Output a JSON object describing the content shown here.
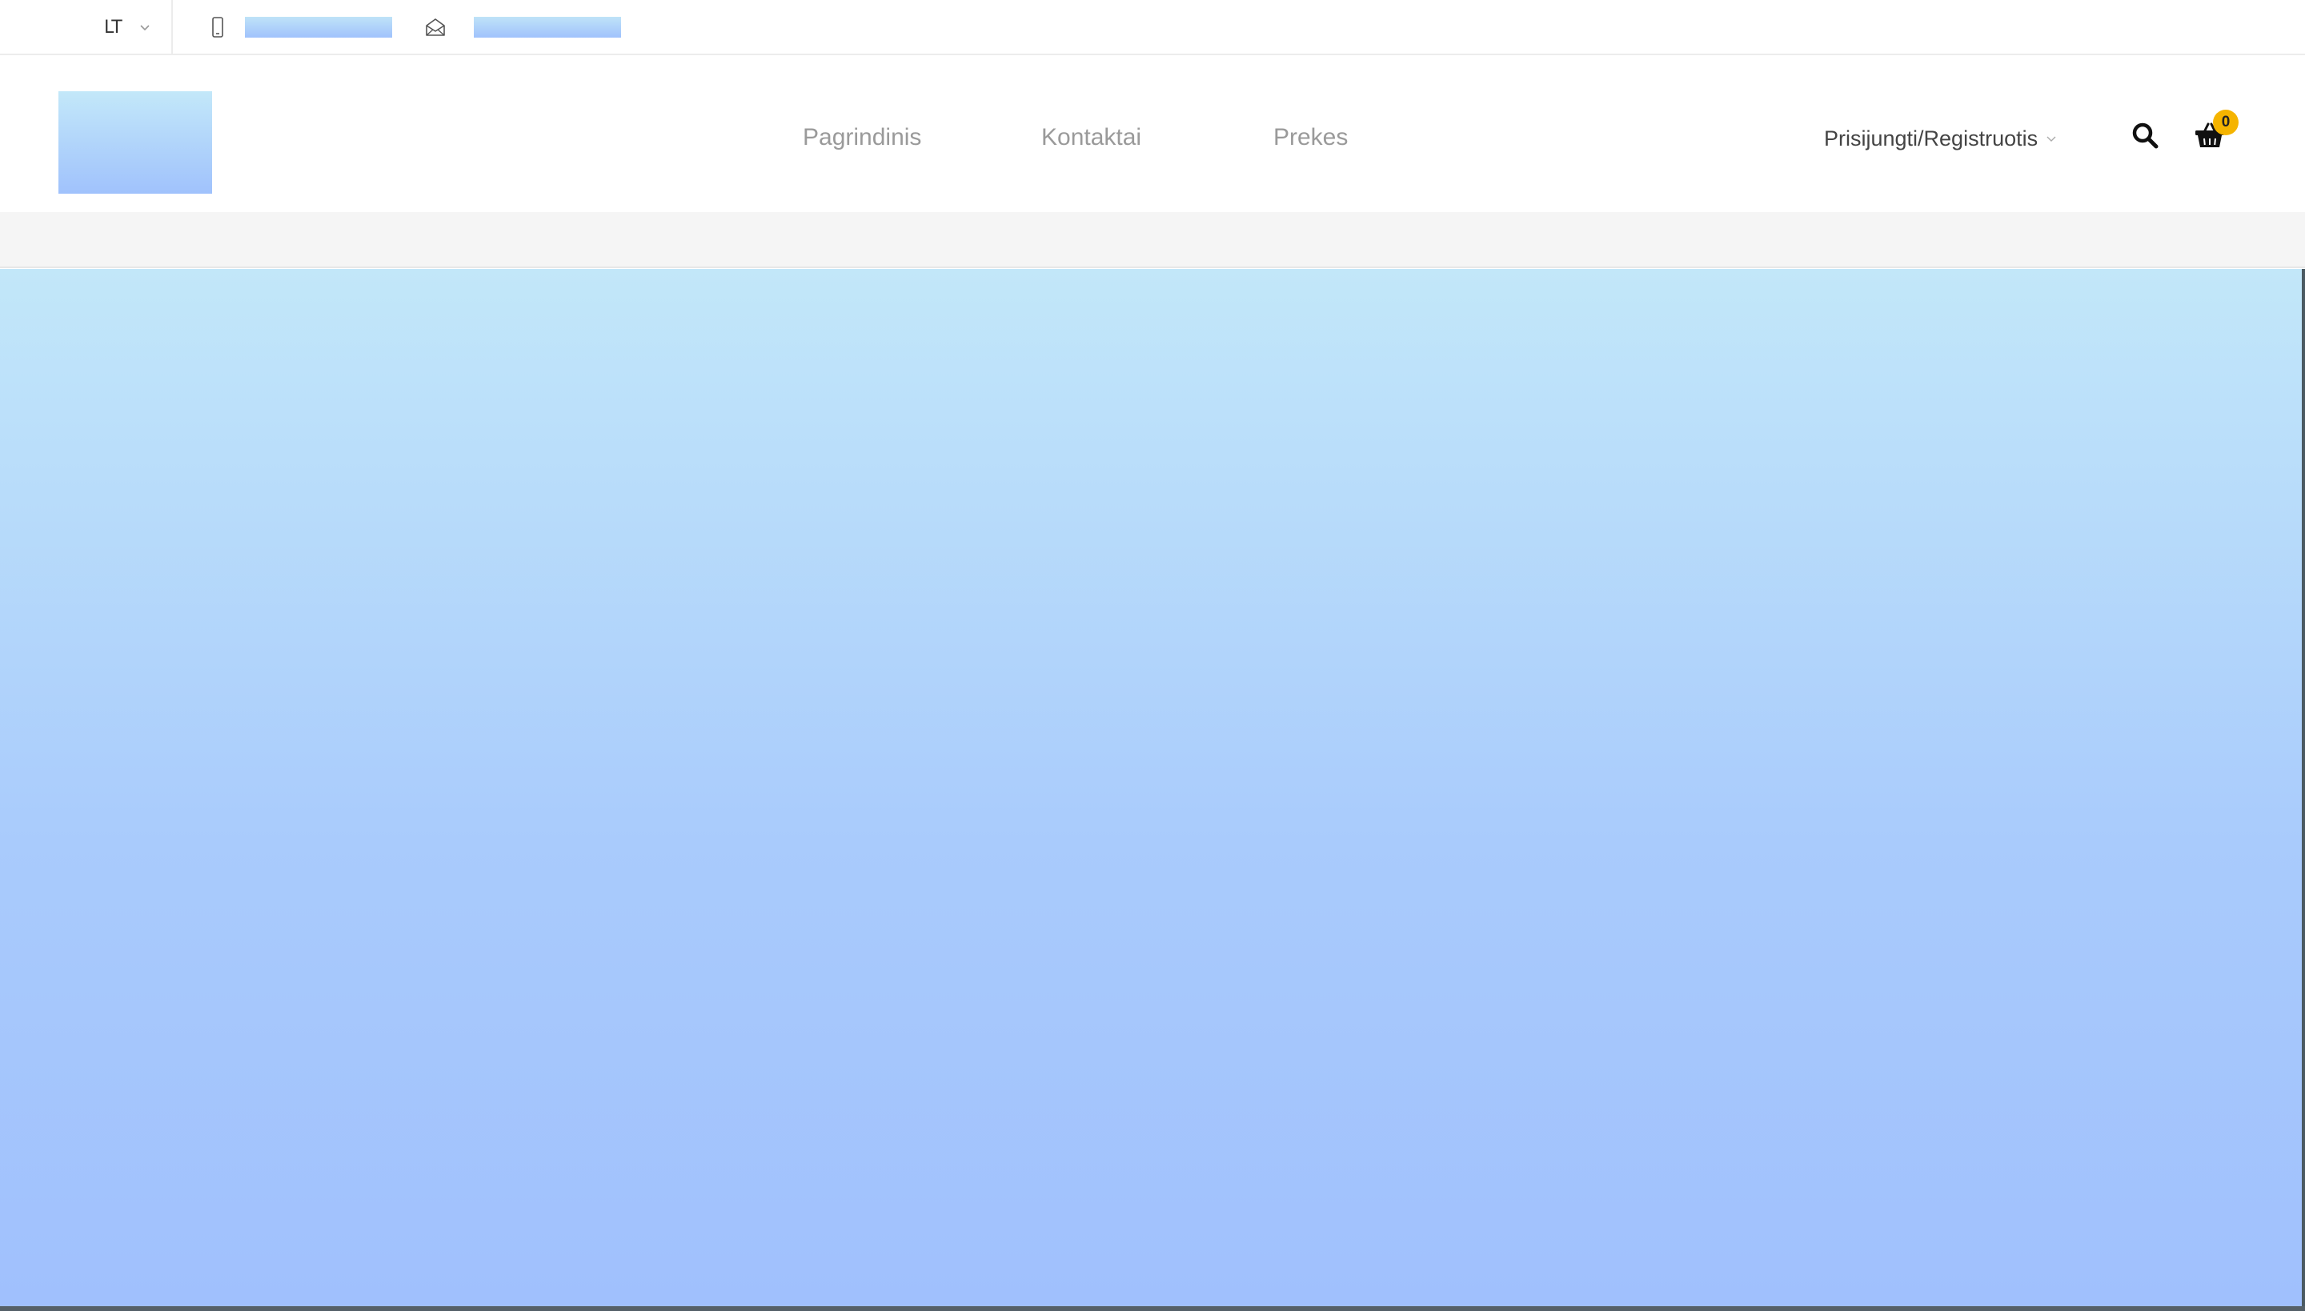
{
  "topbar": {
    "language": "LT",
    "phone_value": "",
    "email_value": ""
  },
  "icons": {
    "language_chevron": "chevron-down-icon",
    "phone": "mobile-phone-icon",
    "email": "envelope-open-icon",
    "account_chevron": "chevron-down-icon",
    "search": "search-icon",
    "cart": "shopping-basket-icon"
  },
  "nav": {
    "items": [
      {
        "label": "Pagrindinis"
      },
      {
        "label": "Kontaktai"
      },
      {
        "label": "Prekes"
      }
    ]
  },
  "account": {
    "label": "Prisijungti/Registruotis"
  },
  "cart": {
    "count": "0"
  },
  "colors": {
    "accent_badge": "#f5b400",
    "nav_text": "#9a9a9a",
    "placeholder_gradient_top": "#c2e7f9",
    "placeholder_gradient_bottom": "#a0c0fd",
    "strip_background": "#f5f5f5"
  }
}
